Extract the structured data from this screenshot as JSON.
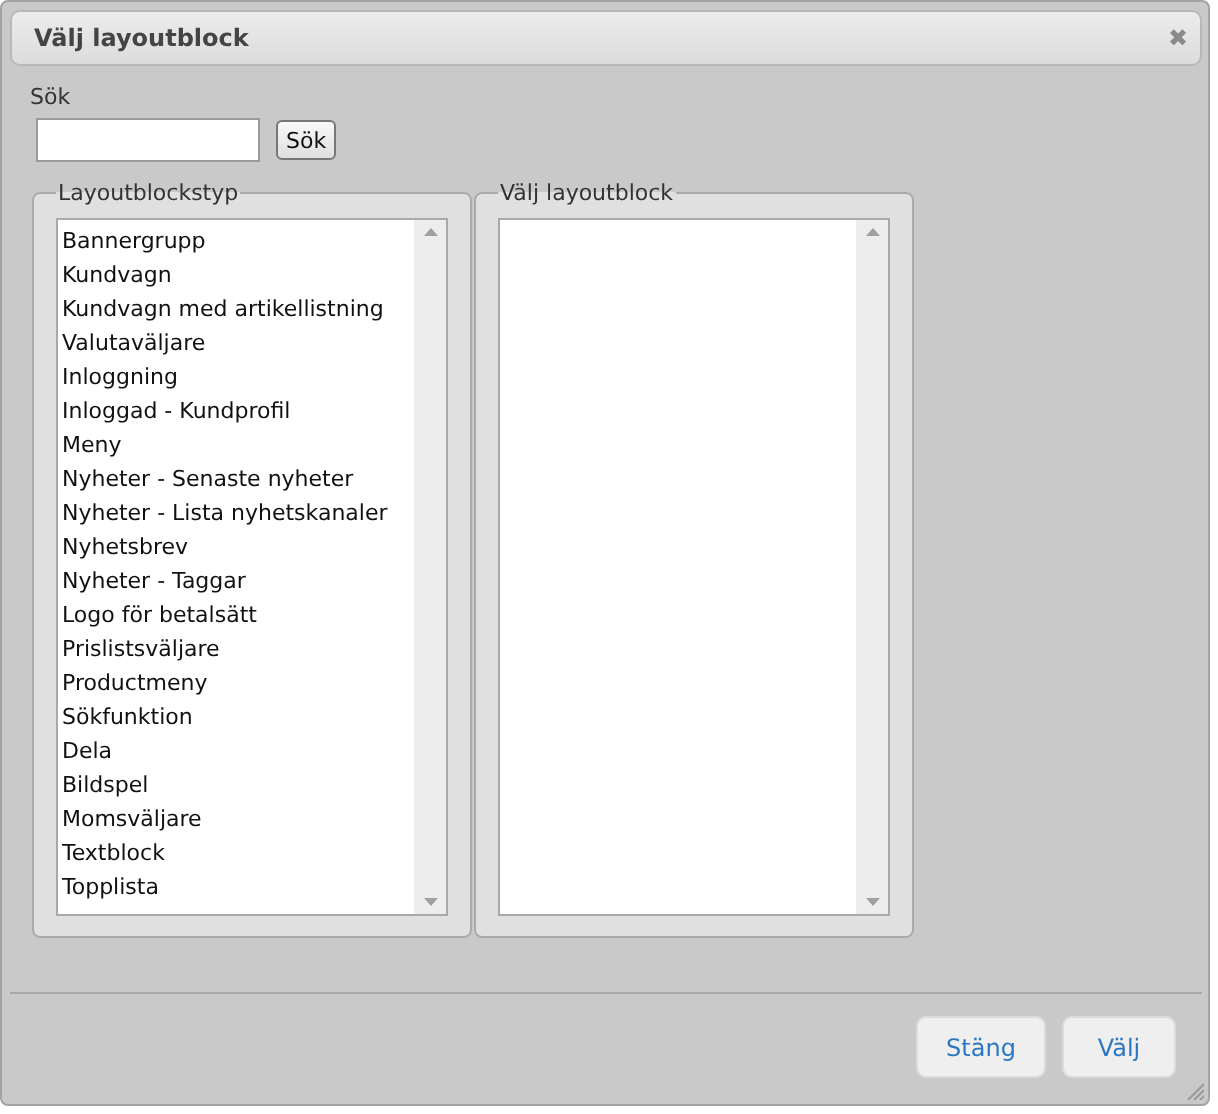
{
  "dialog": {
    "title": "Välj layoutblock",
    "close_icon": "✖"
  },
  "search": {
    "label": "Sök",
    "button": "Sök"
  },
  "panels": [
    {
      "legend": "Layoutblockstyp",
      "items": [
        "Bannergrupp",
        "Kundvagn",
        "Kundvagn med artikellistning",
        "Valutaväljare",
        "Inloggning",
        "Inloggad - Kundprofil",
        "Meny",
        "Nyheter - Senaste nyheter",
        "Nyheter - Lista nyhetskanaler",
        "Nyhetsbrev",
        "Nyheter - Taggar",
        "Logo för betalsätt",
        "Prislistsväljare",
        "Productmeny",
        "Sökfunktion",
        "Dela",
        "Bildspel",
        "Momsväljare",
        "Textblock",
        "Topplista"
      ]
    },
    {
      "legend": "Välj layoutblock"
    }
  ],
  "buttons": [
    "Stäng",
    "Välj"
  ]
}
